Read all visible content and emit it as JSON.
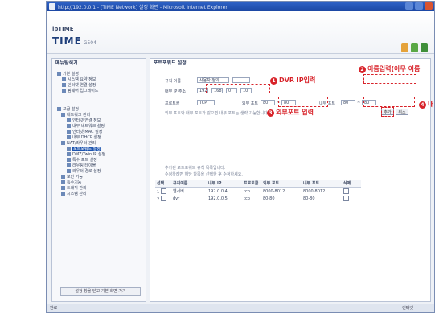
{
  "window": {
    "title": "http://192.0.0.1 - [TIME Network] 설정 화면 - Microsoft Internet Explorer"
  },
  "brand": {
    "top": "ipTIME",
    "name": "TIME",
    "model": "G504"
  },
  "sidebar": {
    "title": "메뉴탐색기",
    "items": [
      {
        "label": "기본 설정"
      },
      {
        "label": "시스템 요약 정보"
      },
      {
        "label": "인터넷 연결 설정"
      },
      {
        "label": "펌웨어 업그레이드"
      },
      {
        "label": "고급 설정"
      },
      {
        "label": "네트워크 관리"
      },
      {
        "label": "인터넷 연결 정보"
      },
      {
        "label": "내부 네트워크 설정"
      },
      {
        "label": "인터넷 MAC 설정"
      },
      {
        "label": "내부 DHCP 설정"
      },
      {
        "label": "NAT/라우터 관리"
      },
      {
        "label": "포트포워드 설정"
      },
      {
        "label": "DMZ/Twin IP 설정"
      },
      {
        "label": "특수 포트 설정"
      },
      {
        "label": "라우팅 테이블"
      },
      {
        "label": "라우터 경로 설정"
      },
      {
        "label": "보안 기능"
      },
      {
        "label": "특수기능"
      },
      {
        "label": "트래픽 관리"
      },
      {
        "label": "시스템 관리"
      }
    ],
    "bottom_button": "설정 창을 닫고 기본 화면 가기"
  },
  "main": {
    "title": "포트포워드 설정",
    "form": {
      "rule_name_label": "규칙 이름",
      "rule_name_value": "",
      "ip_label": "내부 IP 주소",
      "ip": [
        "192",
        "168",
        "0",
        "10"
      ],
      "protocol_label": "프로토콜",
      "protocol_value": "TCP",
      "ext_port_label": "외부 포트",
      "ext_port_from": "80",
      "ext_port_to": "80",
      "int_port_label": "내부 포트",
      "int_port_from": "80",
      "int_port_to": "80",
      "preset_label": "사용자 정의",
      "note": "외부 포트와 내부 포트가 같으면 내부 포트는 생략 가능합니다."
    },
    "add_button": "추가",
    "cancel_button": "취소",
    "list_note_1": "추가된 포트포워드 규칙 목록입니다.",
    "list_note_2": "수정하려면 해당 항목을 선택한 후 수정하세요.",
    "table": {
      "headers": [
        "선택",
        "규칙이름",
        "내부 IP",
        "프로토콜",
        "외부 포트",
        "내부 포트",
        "삭제"
      ],
      "rows": [
        [
          "1",
          "웹서버",
          "192.0.0.4",
          "tcp",
          "8000-8012",
          "8000-8012"
        ],
        [
          "2",
          "dvr",
          "192.0.0.5",
          "tcp",
          "80-80",
          "80-80"
        ]
      ]
    }
  },
  "annotations": {
    "a1": "DVR IP입력",
    "a2": "이름입력(아무 이름",
    "a3": "외부포트 입력",
    "a4": "내"
  },
  "statusbar": {
    "left": "완료",
    "right": "인터넷"
  },
  "colors": {
    "accent": "#d8232a",
    "titlebar": "#1b47a3"
  }
}
